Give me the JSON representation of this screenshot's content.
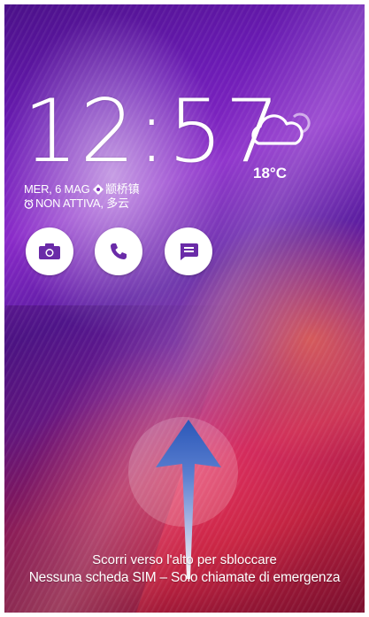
{
  "lockscreen": {
    "time": "12:57",
    "weather": {
      "icon": "cloud-icon",
      "temperature": "18°C"
    },
    "date_text": "MER, 6 MAG",
    "location_text": "颛桥镇",
    "alarm_text": "NON ATTIVA,",
    "condition_text": "多云",
    "shortcuts": [
      {
        "name": "camera",
        "icon": "camera-icon",
        "color": "#6a2ba8"
      },
      {
        "name": "phone",
        "icon": "phone-icon",
        "color": "#6a2ba8"
      },
      {
        "name": "messages",
        "icon": "message-icon",
        "color": "#6a2ba8"
      }
    ],
    "unlock_hint": "Scorri verso l'alto per sbloccare",
    "sim_status": "Nessuna scheda SIM – Solo chiamate di emergenza"
  }
}
